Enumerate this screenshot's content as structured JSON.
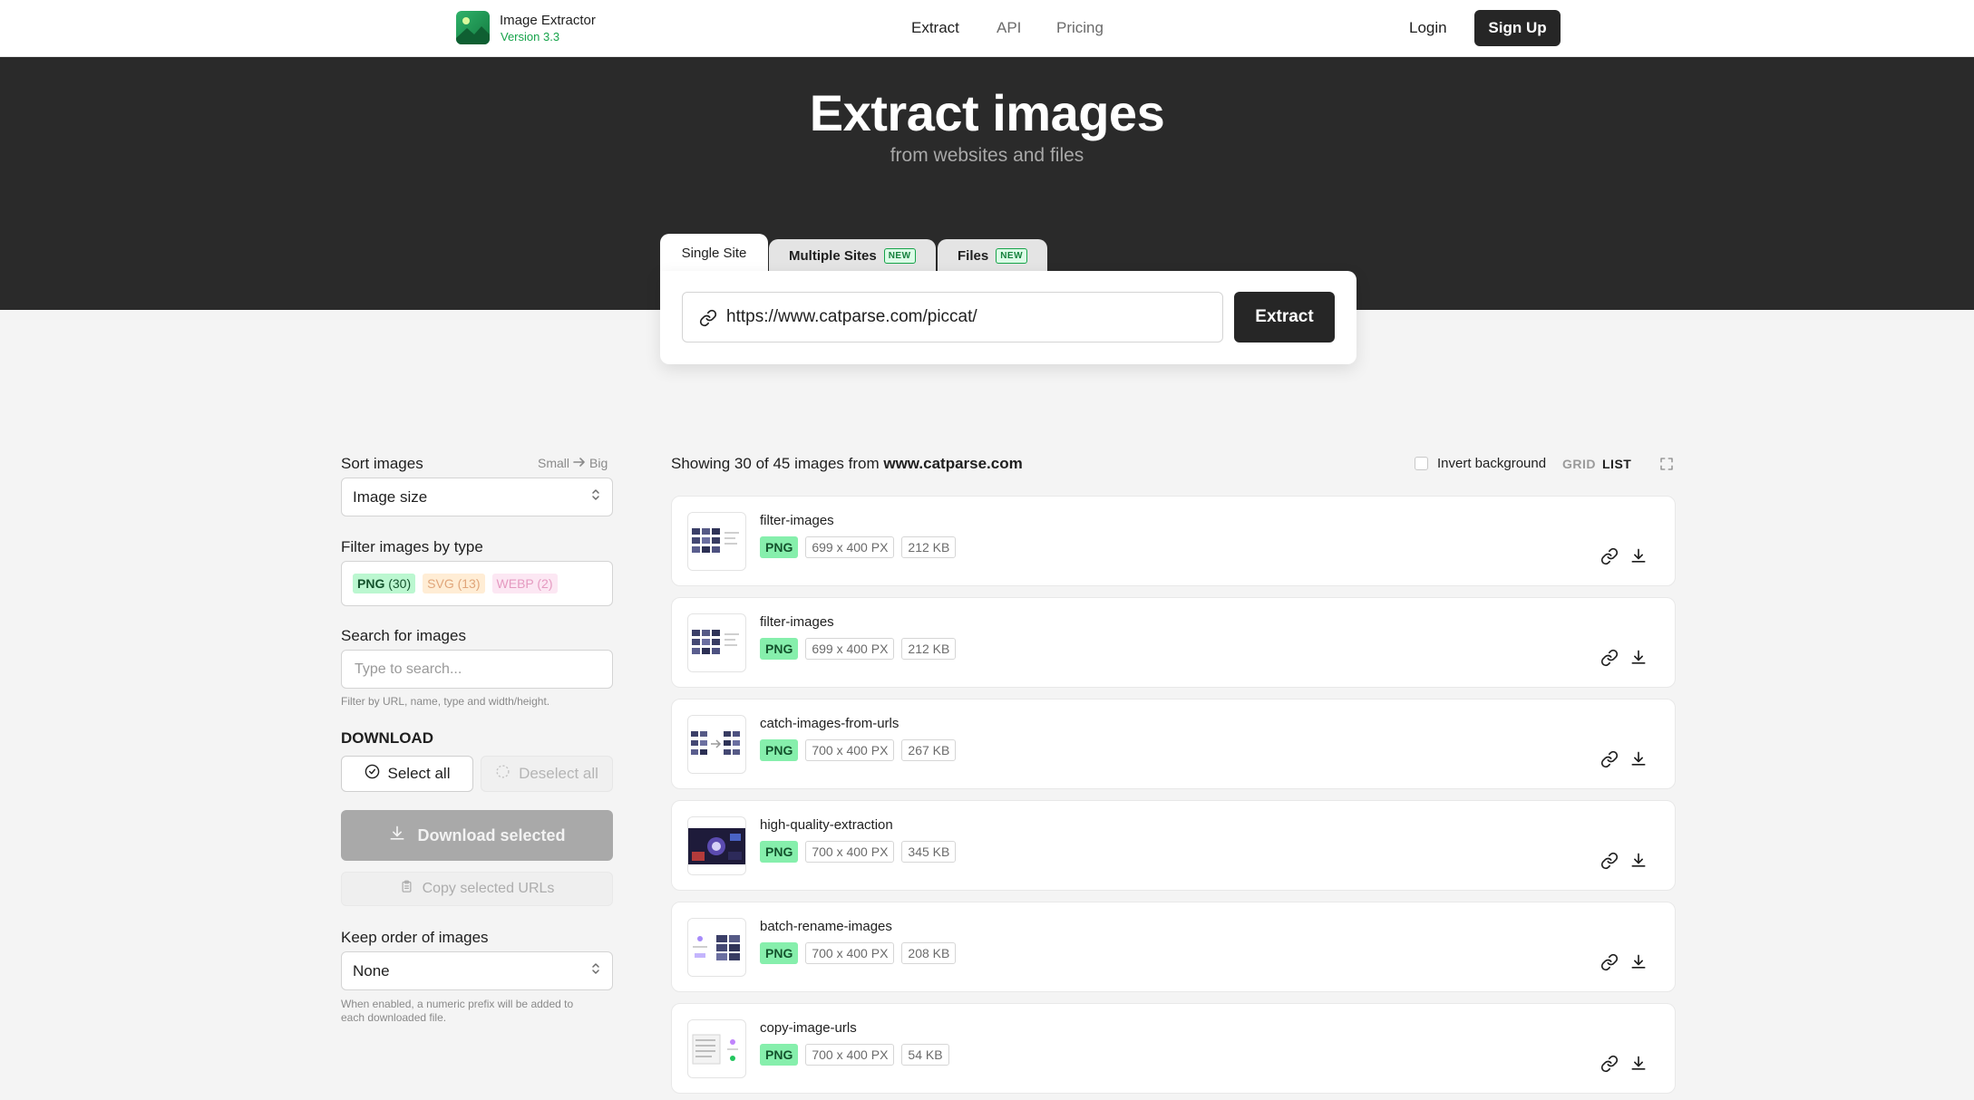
{
  "header": {
    "brand_name": "Image Extractor",
    "brand_version": "Version 3.3",
    "nav": [
      {
        "label": "Extract",
        "active": true
      },
      {
        "label": "API",
        "active": false
      },
      {
        "label": "Pricing",
        "active": false
      }
    ],
    "login_label": "Login",
    "signup_label": "Sign Up"
  },
  "hero": {
    "title": "Extract images",
    "subtitle": "from websites and files"
  },
  "tabs": [
    {
      "label": "Single Site",
      "badge": "",
      "active": true
    },
    {
      "label": "Multiple Sites",
      "badge": "NEW",
      "active": false
    },
    {
      "label": "Files",
      "badge": "NEW",
      "active": false
    }
  ],
  "extract": {
    "url_value": "https://www.catparse.com/piccat/",
    "button_label": "Extract"
  },
  "sidebar": {
    "sort_label": "Sort images",
    "sort_hint_from": "Small",
    "sort_hint_to": "Big",
    "sort_value": "Image size",
    "filter_label": "Filter images by type",
    "types": [
      {
        "name": "PNG",
        "count": "(30)"
      },
      {
        "name": "SVG",
        "count": "(13)"
      },
      {
        "name": "WEBP",
        "count": "(2)"
      }
    ],
    "search_label": "Search for images",
    "search_placeholder": "Type to search...",
    "search_note": "Filter by URL, name, type and width/height.",
    "download_heading": "DOWNLOAD",
    "select_all_label": "Select all",
    "deselect_all_label": "Deselect all",
    "download_selected_label": "Download selected",
    "copy_urls_label": "Copy selected URLs",
    "keep_order_label": "Keep order of images",
    "keep_order_value": "None",
    "keep_order_note_1": "When enabled, a numeric prefix will be added to",
    "keep_order_note_2": "each downloaded file."
  },
  "results": {
    "showing_text": "Showing 30 of 45 images from",
    "domain": "www.catparse.com",
    "invert_label": "Invert background",
    "view_grid": "GRID",
    "view_list": "LIST",
    "items": [
      {
        "name": "filter-images",
        "type": "PNG",
        "dims": "699 x 400 PX",
        "size": "212 KB"
      },
      {
        "name": "filter-images",
        "type": "PNG",
        "dims": "699 x 400 PX",
        "size": "212 KB"
      },
      {
        "name": "catch-images-from-urls",
        "type": "PNG",
        "dims": "700 x 400 PX",
        "size": "267 KB"
      },
      {
        "name": "high-quality-extraction",
        "type": "PNG",
        "dims": "700 x 400 PX",
        "size": "345 KB"
      },
      {
        "name": "batch-rename-images",
        "type": "PNG",
        "dims": "700 x 400 PX",
        "size": "208 KB"
      },
      {
        "name": "copy-image-urls",
        "type": "PNG",
        "dims": "700 x 400 PX",
        "size": "54 KB"
      }
    ]
  },
  "icons": {
    "logo": "image-extractor-logo-icon",
    "url": "link-icon",
    "sort": "updown-chevron-icon",
    "select_all": "check-circle-icon",
    "deselect_all": "dashed-circle-icon",
    "download": "download-icon",
    "copy": "clipboard-icon",
    "row_link": "link-icon",
    "row_download": "download-icon",
    "expand": "expand-icon"
  },
  "colors": {
    "accent_green": "#16a34a",
    "hero_bg": "#2a2a2a",
    "primary_button": "#262626"
  }
}
